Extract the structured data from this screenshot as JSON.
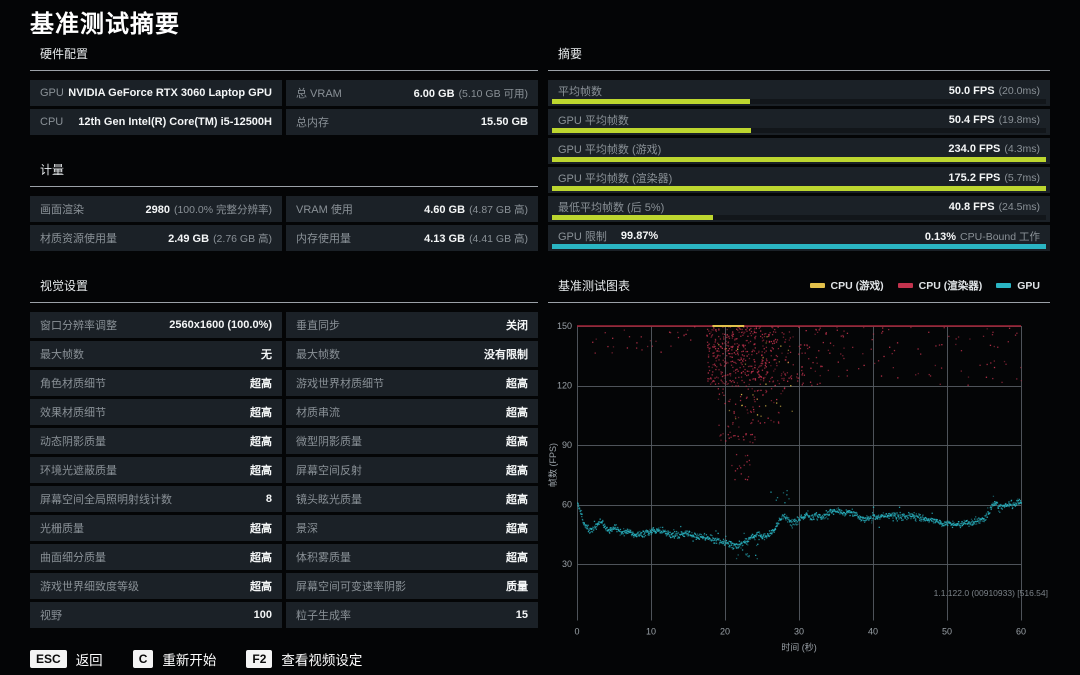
{
  "page_title": "基准测试摘要",
  "colors": {
    "lime": "#bdd62f",
    "teal": "#2ab5c3",
    "legend_yellow": "#e3c14b",
    "legend_red": "#c2334d",
    "legend_teal": "#2ab5c3",
    "row_bg": "#1b2127",
    "grid": "#565c63",
    "cap_red": "#a32337"
  },
  "hardware": {
    "title": "硬件配置",
    "rows": [
      {
        "cells": [
          {
            "label": "GPU",
            "value": "NVIDIA GeForce RTX 3060 Laptop GPU",
            "note": ""
          },
          {
            "label": "总 VRAM",
            "value": "6.00 GB",
            "note": "(5.10 GB 可用)"
          }
        ]
      },
      {
        "cells": [
          {
            "label": "CPU",
            "value": "12th Gen Intel(R) Core(TM) i5-12500H",
            "note": ""
          },
          {
            "label": "总内存",
            "value": "15.50 GB",
            "note": ""
          }
        ]
      }
    ]
  },
  "metrics": {
    "title": "计量",
    "rows": [
      {
        "cells": [
          {
            "label": "画面渲染",
            "value": "2980",
            "note": "(100.0% 完整分辨率)"
          },
          {
            "label": "VRAM 使用",
            "value": "4.60 GB",
            "note": "(4.87 GB 高)"
          }
        ]
      },
      {
        "cells": [
          {
            "label": "材质资源使用量",
            "value": "2.49 GB",
            "note": "(2.76 GB 高)"
          },
          {
            "label": "内存使用量",
            "value": "4.13 GB",
            "note": "(4.41 GB 高)"
          }
        ]
      }
    ]
  },
  "visual_settings": {
    "title": "视觉设置",
    "rows": [
      {
        "cells": [
          {
            "label": "窗口分辨率调整",
            "value": "2560x1600 (100.0%)",
            "note": ""
          },
          {
            "label": "垂直同步",
            "value": "关闭",
            "note": ""
          }
        ]
      },
      {
        "cells": [
          {
            "label": "最大帧数",
            "value": "无",
            "note": ""
          },
          {
            "label": "最大帧数",
            "value": "没有限制",
            "note": ""
          }
        ]
      },
      {
        "cells": [
          {
            "label": "角色材质细节",
            "value": "超高",
            "note": ""
          },
          {
            "label": "游戏世界材质细节",
            "value": "超高",
            "note": ""
          }
        ]
      },
      {
        "cells": [
          {
            "label": "效果材质细节",
            "value": "超高",
            "note": ""
          },
          {
            "label": "材质串流",
            "value": "超高",
            "note": ""
          }
        ]
      },
      {
        "cells": [
          {
            "label": "动态阴影质量",
            "value": "超高",
            "note": ""
          },
          {
            "label": "微型阴影质量",
            "value": "超高",
            "note": ""
          }
        ]
      },
      {
        "cells": [
          {
            "label": "环境光遮蔽质量",
            "value": "超高",
            "note": ""
          },
          {
            "label": "屏幕空间反射",
            "value": "超高",
            "note": ""
          }
        ]
      },
      {
        "cells": [
          {
            "label": "屏幕空间全局照明射线计数",
            "value": "8",
            "note": ""
          },
          {
            "label": "镜头眩光质量",
            "value": "超高",
            "note": ""
          }
        ]
      },
      {
        "cells": [
          {
            "label": "光栅质量",
            "value": "超高",
            "note": ""
          },
          {
            "label": "景深",
            "value": "超高",
            "note": ""
          }
        ]
      },
      {
        "cells": [
          {
            "label": "曲面细分质量",
            "value": "超高",
            "note": ""
          },
          {
            "label": "体积雾质量",
            "value": "超高",
            "note": ""
          }
        ]
      },
      {
        "cells": [
          {
            "label": "游戏世界细致度等级",
            "value": "超高",
            "note": ""
          },
          {
            "label": "屏幕空间可变速率阴影",
            "value": "质量",
            "note": ""
          }
        ]
      },
      {
        "cells": [
          {
            "label": "视野",
            "value": "100",
            "note": ""
          },
          {
            "label": "粒子生成率",
            "value": "15",
            "note": ""
          }
        ]
      }
    ]
  },
  "summary": {
    "title": "摘要",
    "rows": [
      {
        "label": "平均帧数",
        "value": "50.0 FPS",
        "note": "(20.0ms)",
        "pct": 40,
        "color": "lime"
      },
      {
        "label": "GPU 平均帧数",
        "value": "50.4 FPS",
        "note": "(19.8ms)",
        "pct": 40.3,
        "color": "lime"
      },
      {
        "label": "GPU 平均帧数 (游戏)",
        "value": "234.0 FPS",
        "note": "(4.3ms)",
        "pct": 100,
        "color": "lime"
      },
      {
        "label": "GPU 平均帧数 (渲染器)",
        "value": "175.2 FPS",
        "note": "(5.7ms)",
        "pct": 100,
        "color": "lime"
      },
      {
        "label": "最低平均帧数 (后 5%)",
        "value": "40.8 FPS",
        "note": "(24.5ms)",
        "pct": 32.6,
        "color": "lime"
      },
      {
        "limit": true,
        "left_label": "GPU 限制",
        "left_value": "99.87%",
        "right_value": "0.13%",
        "right_label": "CPU-Bound 工作",
        "pct": 100,
        "color": "teal"
      }
    ]
  },
  "chart_panel": {
    "title": "基准测试图表",
    "legend": [
      {
        "label": "CPU (游戏)",
        "color": "#e3c14b"
      },
      {
        "label": "CPU (渲染器)",
        "color": "#c2334d"
      },
      {
        "label": "GPU",
        "color": "#2ab5c3"
      }
    ],
    "version_text": "1.1.122.0 (00910933) [516.54]"
  },
  "chart_data": {
    "type": "scatter",
    "title": "基准测试图表",
    "xlabel": "时间 (秒)",
    "ylabel": "帧数 (FPS)",
    "xlim": [
      0,
      60
    ],
    "ylim": [
      0,
      155
    ],
    "xticks": [
      0,
      10,
      20,
      30,
      40,
      50,
      60
    ],
    "yticks": [
      30,
      60,
      90,
      120,
      150
    ],
    "grid": true,
    "legend_position": "top-right",
    "series": [
      {
        "name": "CPU (渲染器)",
        "color": "#c2334d",
        "render": "cap_scatter",
        "cap_y": 150,
        "cap_line_width": 1.4,
        "cap_segments": [
          [
            0,
            60
          ]
        ],
        "clusters": [
          {
            "x": [
              2,
              12
            ],
            "y": [
              136,
              149
            ],
            "count": 20
          },
          {
            "x": [
              12,
              17.5
            ],
            "y": [
              140,
              150
            ],
            "count": 12
          },
          {
            "x": [
              17.5,
              23
            ],
            "y": [
              120,
              150
            ],
            "count": 260
          },
          {
            "x": [
              23,
              27
            ],
            "y": [
              122,
              150
            ],
            "count": 150
          },
          {
            "x": [
              19,
              24
            ],
            "y": [
              90,
              122
            ],
            "count": 70
          },
          {
            "x": [
              24,
              28
            ],
            "y": [
              100,
              128
            ],
            "count": 40
          },
          {
            "x": [
              20.5,
              23.5
            ],
            "y": [
              72,
              92
            ],
            "count": 18
          },
          {
            "x": [
              27,
              33
            ],
            "y": [
              120,
              150
            ],
            "count": 80
          },
          {
            "x": [
              33,
              48
            ],
            "y": [
              124,
              150
            ],
            "count": 55
          },
          {
            "x": [
              48,
              60
            ],
            "y": [
              120,
              150
            ],
            "count": 40
          }
        ]
      },
      {
        "name": "CPU (游戏)",
        "color": "#e3c14b",
        "render": "cap_scatter",
        "cap_y": 150,
        "cap_line_width": 2,
        "cap_segments": [
          [
            18.3,
            22.6
          ]
        ],
        "clusters": [
          {
            "x": [
              19,
              30
            ],
            "y": [
              102,
              147
            ],
            "count": 26
          }
        ]
      },
      {
        "name": "GPU",
        "color": "#2ab5c3",
        "render": "noisy_line",
        "jitter": 1.6,
        "dots": 1400,
        "points": [
          [
            0,
            61
          ],
          [
            0.4,
            57
          ],
          [
            0.8,
            51
          ],
          [
            1.5,
            48
          ],
          [
            2,
            47
          ],
          [
            2.6,
            50
          ],
          [
            3.2,
            52
          ],
          [
            3.8,
            48
          ],
          [
            4.5,
            47
          ],
          [
            5,
            49
          ],
          [
            5.6,
            47
          ],
          [
            6.2,
            46
          ],
          [
            7,
            47
          ],
          [
            7.6,
            45
          ],
          [
            8.2,
            45
          ],
          [
            9,
            46
          ],
          [
            10,
            47
          ],
          [
            11,
            47
          ],
          [
            12,
            46
          ],
          [
            13,
            45
          ],
          [
            13.8,
            45
          ],
          [
            14.6,
            46
          ],
          [
            15.4,
            45
          ],
          [
            16.2,
            44
          ],
          [
            17,
            44
          ],
          [
            18,
            43
          ],
          [
            19,
            42
          ],
          [
            20,
            41
          ],
          [
            20.8,
            40
          ],
          [
            21.4,
            39
          ],
          [
            22,
            40
          ],
          [
            22.8,
            42
          ],
          [
            23.6,
            44
          ],
          [
            24.4,
            45
          ],
          [
            25,
            44
          ],
          [
            25.8,
            45
          ],
          [
            26.6,
            47
          ],
          [
            27.2,
            52
          ],
          [
            27.8,
            55
          ],
          [
            28.4,
            53
          ],
          [
            29,
            51
          ],
          [
            29.6,
            52
          ],
          [
            30.4,
            54
          ],
          [
            31,
            55
          ],
          [
            31.6,
            53
          ],
          [
            32.2,
            55
          ],
          [
            33,
            54
          ],
          [
            34,
            56
          ],
          [
            35,
            57
          ],
          [
            36,
            56
          ],
          [
            37,
            57
          ],
          [
            38,
            54
          ],
          [
            39,
            53
          ],
          [
            40,
            54
          ],
          [
            41,
            54
          ],
          [
            42,
            55
          ],
          [
            43,
            55
          ],
          [
            44,
            54
          ],
          [
            45,
            55
          ],
          [
            46,
            54
          ],
          [
            47,
            53
          ],
          [
            48,
            52
          ],
          [
            49,
            51
          ],
          [
            50,
            51
          ],
          [
            51,
            50
          ],
          [
            52,
            51
          ],
          [
            53,
            51
          ],
          [
            54,
            52
          ],
          [
            55,
            53
          ],
          [
            55.6,
            56
          ],
          [
            56,
            60
          ],
          [
            56.4,
            61
          ],
          [
            57,
            59
          ],
          [
            58,
            60
          ],
          [
            59,
            60
          ],
          [
            60,
            62
          ]
        ],
        "clusters": [
          {
            "x": [
              20.5,
              24.5
            ],
            "y": [
              32,
              40
            ],
            "count": 12
          },
          {
            "x": [
              26,
              29
            ],
            "y": [
              60,
              68
            ],
            "count": 8
          }
        ]
      }
    ]
  },
  "footer": {
    "keys": [
      {
        "key": "ESC",
        "label": "返回"
      },
      {
        "key": "C",
        "label": "重新开始"
      },
      {
        "key": "F2",
        "label": "查看视频设定"
      }
    ]
  }
}
